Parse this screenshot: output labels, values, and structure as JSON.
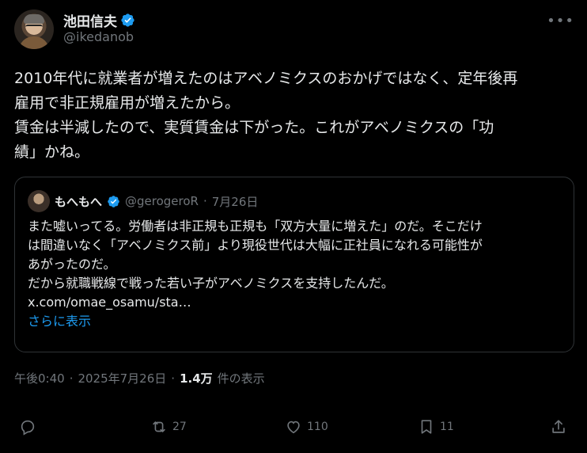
{
  "author": {
    "display_name": "池田信夫",
    "handle": "@ikedanob"
  },
  "tweet": {
    "text": "2010年代に就業者が増えたのはアベノミクスのおかげではなく、定年後再\n雇用で非正規雇用が増えたから。\n賃金は半減したので、実質賃金は下がった。これがアベノミクスの「功\n績」かね。"
  },
  "quote": {
    "display_name": "もへもへ",
    "handle": "@gerogeroR",
    "separator": "·",
    "date": "7月26日",
    "text": "また嘘いってる。労働者は非正規も正規も「双方大量に増えた」のだ。そこだけ\nは間違いなく「アベノミクス前」より現役世代は大幅に正社員になれる可能性が\nあがったのだ。\nだから就職戦線で戦った若い子がアベノミクスを支持したんだ。",
    "link": "x.com/omae_osamu/sta…",
    "show_more": "さらに表示"
  },
  "meta": {
    "time": "午後0:40",
    "sep1": "·",
    "date": "2025年7月26日",
    "sep2": "·",
    "views": "1.4万",
    "views_label": "件の表示"
  },
  "actions": {
    "retweets": "27",
    "likes": "110",
    "bookmarks": "11"
  },
  "colors": {
    "background": "#000000",
    "text": "#e7e9ea",
    "secondary": "#71767b",
    "accent": "#1d9bf0",
    "border": "#2f3336"
  },
  "icons": {
    "more": "more-icon",
    "verified": "verified-badge-icon",
    "reply": "reply-icon",
    "retweet": "retweet-icon",
    "like": "heart-icon",
    "bookmark": "bookmark-icon",
    "share": "share-icon"
  }
}
